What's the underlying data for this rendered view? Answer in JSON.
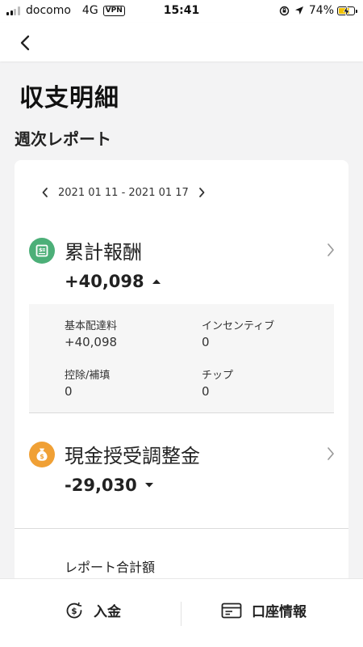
{
  "status_bar": {
    "carrier": "docomo",
    "network": "4G",
    "vpn": "VPN",
    "time": "15:41",
    "battery_pct": "74%",
    "battery_level": 0.74,
    "battery_color": "#f2c200"
  },
  "header": {
    "back_icon": "chevron-left-icon"
  },
  "page": {
    "title": "収支明細",
    "section_title": "週次レポート"
  },
  "week": {
    "range": "2021 01 11 - 2021 01 17",
    "prev_icon": "chevron-left-icon",
    "next_icon": "chevron-right-icon"
  },
  "earnings": {
    "label": "累計報酬",
    "amount": "+40,098",
    "icon": "receipt-icon",
    "icon_color": "#4caf78",
    "caret": "caret-up-icon",
    "breakdown": {
      "base_label": "基本配達料",
      "base_value": "+40,098",
      "incentive_label": "インセンティブ",
      "incentive_value": "0",
      "deduction_label": "控除/補填",
      "deduction_value": "0",
      "tip_label": "チップ",
      "tip_value": "0"
    }
  },
  "cash": {
    "label": "現金授受調整金",
    "amount": "-29,030",
    "icon": "money-bag-icon",
    "icon_color": "#f0a035",
    "caret": "caret-down-icon"
  },
  "report_total": {
    "label": "レポート合計額"
  },
  "bottom_bar": {
    "deposit_label": "入金",
    "deposit_icon": "dollar-circle-icon",
    "account_label": "口座情報",
    "account_icon": "card-icon"
  }
}
